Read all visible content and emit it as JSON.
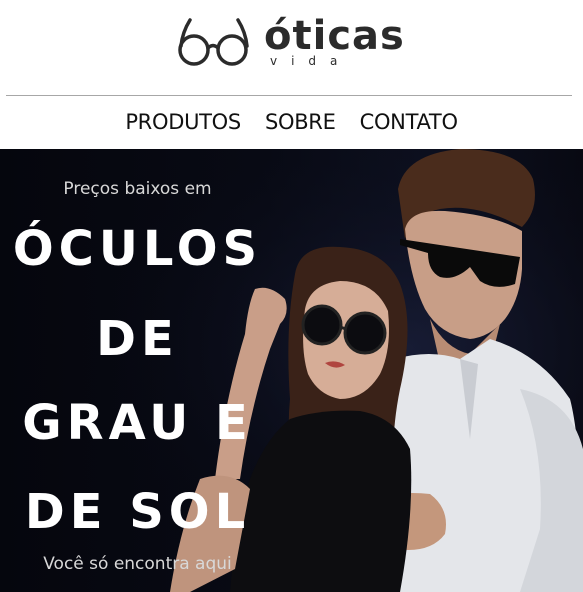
{
  "brand": {
    "name": "óticas",
    "sub": "vida",
    "logo_icon": "glasses-icon"
  },
  "nav": {
    "items": [
      {
        "label": "PRODUTOS"
      },
      {
        "label": "SOBRE"
      },
      {
        "label": "CONTATO"
      }
    ]
  },
  "hero": {
    "pretitle": "Preços baixos em",
    "headline_lines": [
      "ÓCULOS",
      "DE",
      "GRAU E",
      "DE SOL"
    ],
    "subtitle": "Você só encontra aqui"
  },
  "colors": {
    "header_bg": "#ffffff",
    "text_dark": "#2b2b2b",
    "hero_bg": "#05060d",
    "hero_text": "#ffffff"
  }
}
